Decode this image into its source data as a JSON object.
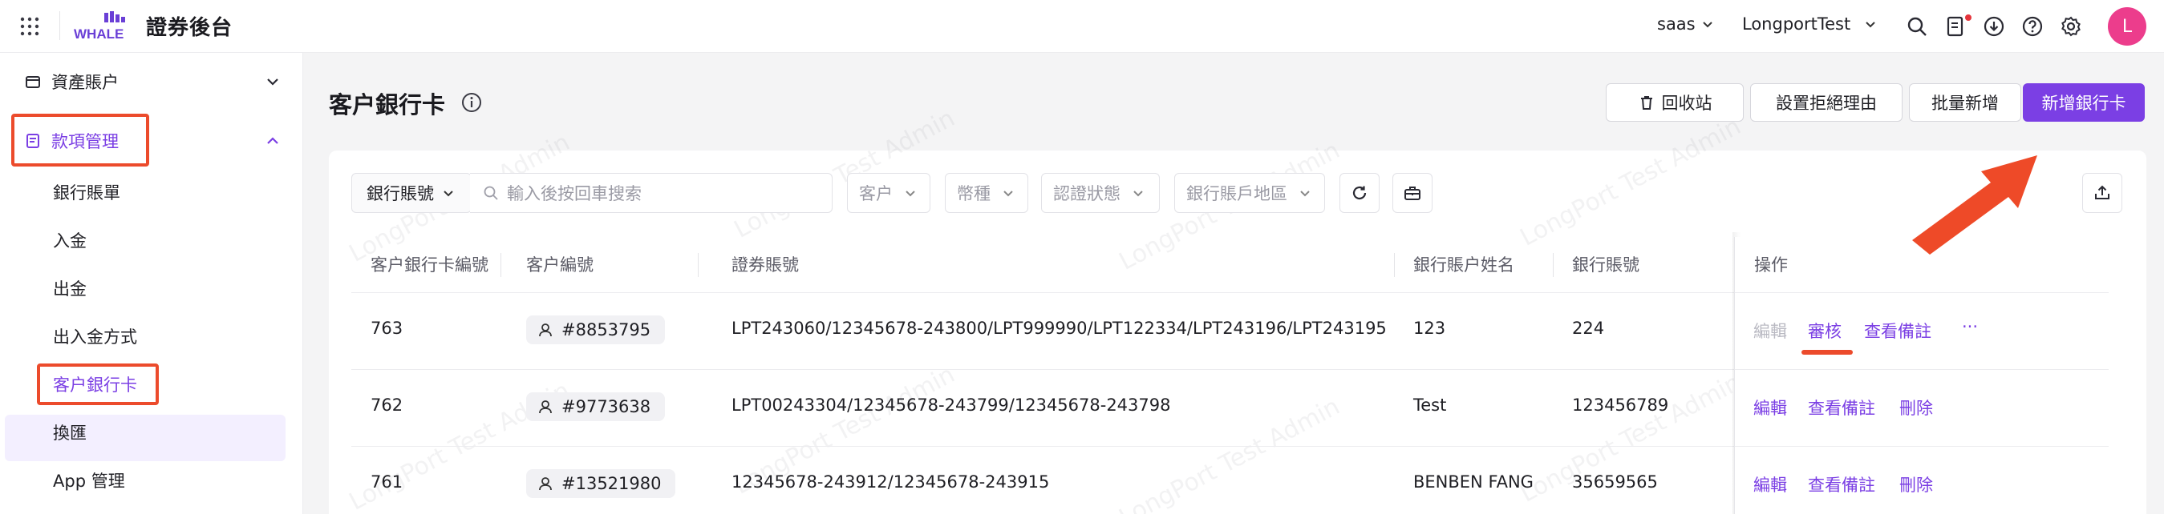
{
  "app": {
    "title": "證券後台"
  },
  "topbar": {
    "tenant": "saas",
    "environment": "LongportTest",
    "avatar_initial": "L",
    "icons": [
      "search-icon",
      "document-notification-icon",
      "download-cloud-icon",
      "help-icon",
      "settings-icon"
    ]
  },
  "sidebar": {
    "groups": [
      {
        "label": "資產賬户"
      },
      {
        "label": "款項管理"
      }
    ],
    "items": [
      {
        "label": "銀行賬單"
      },
      {
        "label": "入金"
      },
      {
        "label": "出金"
      },
      {
        "label": "出入金方式"
      },
      {
        "label": "客户銀行卡"
      },
      {
        "label": "換匯"
      },
      {
        "label": "App 管理"
      }
    ]
  },
  "page": {
    "title": "客户銀行卡",
    "buttons": {
      "recycle": "回收站",
      "reject_reason": "設置拒絕理由",
      "batch_add": "批量新增",
      "add_card": "新增銀行卡"
    }
  },
  "filters": {
    "field_select": "銀行賬號",
    "search_placeholder": "輸入後按回車搜索",
    "customer": "客户",
    "currency": "幣種",
    "auth_status": "認證狀態",
    "bank_region": "銀行賬戶地區"
  },
  "table": {
    "headers": [
      "客户銀行卡編號",
      "客户編號",
      "證券賬號",
      "銀行賬户姓名",
      "銀行賬號",
      "操作"
    ],
    "rows": [
      {
        "id": "763",
        "customer": "#8853795",
        "securities": "LPT243060/12345678-243800/LPT999990/LPT122334/LPT243196/LPT243195",
        "name": "123",
        "bank_no": "224",
        "ops": [
          "編輯",
          "審核",
          "查看備註",
          "···"
        ]
      },
      {
        "id": "762",
        "customer": "#9773638",
        "securities": "LPT00243304/12345678-243799/12345678-243798",
        "name": "Test",
        "bank_no": "123456789",
        "ops": [
          "編輯",
          "查看備註",
          "刪除"
        ]
      },
      {
        "id": "761",
        "customer": "#13521980",
        "securities": "12345678-243912/12345678-243915",
        "name": "BENBEN FANG",
        "bank_no": "35659565",
        "ops": [
          "編輯",
          "查看備註",
          "刪除"
        ]
      }
    ]
  },
  "watermark_text": "LongPort Test Admin",
  "colors": {
    "accent": "#7b3fe4",
    "highlight": "#ec4b2c",
    "avatar": "#ec3d8c"
  }
}
